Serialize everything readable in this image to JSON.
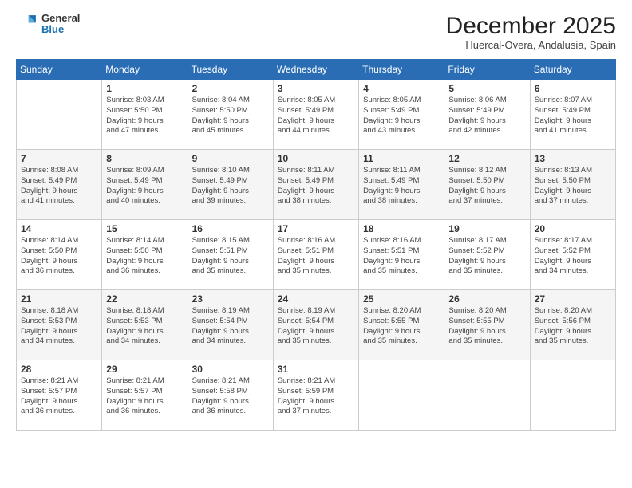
{
  "logo": {
    "general": "General",
    "blue": "Blue"
  },
  "header": {
    "title": "December 2025",
    "subtitle": "Huercal-Overa, Andalusia, Spain"
  },
  "weekdays": [
    "Sunday",
    "Monday",
    "Tuesday",
    "Wednesday",
    "Thursday",
    "Friday",
    "Saturday"
  ],
  "weeks": [
    [
      {
        "day": "",
        "sunrise": "",
        "sunset": "",
        "daylight": ""
      },
      {
        "day": "1",
        "sunrise": "Sunrise: 8:03 AM",
        "sunset": "Sunset: 5:50 PM",
        "daylight": "Daylight: 9 hours and 47 minutes."
      },
      {
        "day": "2",
        "sunrise": "Sunrise: 8:04 AM",
        "sunset": "Sunset: 5:50 PM",
        "daylight": "Daylight: 9 hours and 45 minutes."
      },
      {
        "day": "3",
        "sunrise": "Sunrise: 8:05 AM",
        "sunset": "Sunset: 5:49 PM",
        "daylight": "Daylight: 9 hours and 44 minutes."
      },
      {
        "day": "4",
        "sunrise": "Sunrise: 8:05 AM",
        "sunset": "Sunset: 5:49 PM",
        "daylight": "Daylight: 9 hours and 43 minutes."
      },
      {
        "day": "5",
        "sunrise": "Sunrise: 8:06 AM",
        "sunset": "Sunset: 5:49 PM",
        "daylight": "Daylight: 9 hours and 42 minutes."
      },
      {
        "day": "6",
        "sunrise": "Sunrise: 8:07 AM",
        "sunset": "Sunset: 5:49 PM",
        "daylight": "Daylight: 9 hours and 41 minutes."
      }
    ],
    [
      {
        "day": "7",
        "sunrise": "Sunrise: 8:08 AM",
        "sunset": "Sunset: 5:49 PM",
        "daylight": "Daylight: 9 hours and 41 minutes."
      },
      {
        "day": "8",
        "sunrise": "Sunrise: 8:09 AM",
        "sunset": "Sunset: 5:49 PM",
        "daylight": "Daylight: 9 hours and 40 minutes."
      },
      {
        "day": "9",
        "sunrise": "Sunrise: 8:10 AM",
        "sunset": "Sunset: 5:49 PM",
        "daylight": "Daylight: 9 hours and 39 minutes."
      },
      {
        "day": "10",
        "sunrise": "Sunrise: 8:11 AM",
        "sunset": "Sunset: 5:49 PM",
        "daylight": "Daylight: 9 hours and 38 minutes."
      },
      {
        "day": "11",
        "sunrise": "Sunrise: 8:11 AM",
        "sunset": "Sunset: 5:49 PM",
        "daylight": "Daylight: 9 hours and 38 minutes."
      },
      {
        "day": "12",
        "sunrise": "Sunrise: 8:12 AM",
        "sunset": "Sunset: 5:50 PM",
        "daylight": "Daylight: 9 hours and 37 minutes."
      },
      {
        "day": "13",
        "sunrise": "Sunrise: 8:13 AM",
        "sunset": "Sunset: 5:50 PM",
        "daylight": "Daylight: 9 hours and 37 minutes."
      }
    ],
    [
      {
        "day": "14",
        "sunrise": "Sunrise: 8:14 AM",
        "sunset": "Sunset: 5:50 PM",
        "daylight": "Daylight: 9 hours and 36 minutes."
      },
      {
        "day": "15",
        "sunrise": "Sunrise: 8:14 AM",
        "sunset": "Sunset: 5:50 PM",
        "daylight": "Daylight: 9 hours and 36 minutes."
      },
      {
        "day": "16",
        "sunrise": "Sunrise: 8:15 AM",
        "sunset": "Sunset: 5:51 PM",
        "daylight": "Daylight: 9 hours and 35 minutes."
      },
      {
        "day": "17",
        "sunrise": "Sunrise: 8:16 AM",
        "sunset": "Sunset: 5:51 PM",
        "daylight": "Daylight: 9 hours and 35 minutes."
      },
      {
        "day": "18",
        "sunrise": "Sunrise: 8:16 AM",
        "sunset": "Sunset: 5:51 PM",
        "daylight": "Daylight: 9 hours and 35 minutes."
      },
      {
        "day": "19",
        "sunrise": "Sunrise: 8:17 AM",
        "sunset": "Sunset: 5:52 PM",
        "daylight": "Daylight: 9 hours and 35 minutes."
      },
      {
        "day": "20",
        "sunrise": "Sunrise: 8:17 AM",
        "sunset": "Sunset: 5:52 PM",
        "daylight": "Daylight: 9 hours and 34 minutes."
      }
    ],
    [
      {
        "day": "21",
        "sunrise": "Sunrise: 8:18 AM",
        "sunset": "Sunset: 5:53 PM",
        "daylight": "Daylight: 9 hours and 34 minutes."
      },
      {
        "day": "22",
        "sunrise": "Sunrise: 8:18 AM",
        "sunset": "Sunset: 5:53 PM",
        "daylight": "Daylight: 9 hours and 34 minutes."
      },
      {
        "day": "23",
        "sunrise": "Sunrise: 8:19 AM",
        "sunset": "Sunset: 5:54 PM",
        "daylight": "Daylight: 9 hours and 34 minutes."
      },
      {
        "day": "24",
        "sunrise": "Sunrise: 8:19 AM",
        "sunset": "Sunset: 5:54 PM",
        "daylight": "Daylight: 9 hours and 35 minutes."
      },
      {
        "day": "25",
        "sunrise": "Sunrise: 8:20 AM",
        "sunset": "Sunset: 5:55 PM",
        "daylight": "Daylight: 9 hours and 35 minutes."
      },
      {
        "day": "26",
        "sunrise": "Sunrise: 8:20 AM",
        "sunset": "Sunset: 5:55 PM",
        "daylight": "Daylight: 9 hours and 35 minutes."
      },
      {
        "day": "27",
        "sunrise": "Sunrise: 8:20 AM",
        "sunset": "Sunset: 5:56 PM",
        "daylight": "Daylight: 9 hours and 35 minutes."
      }
    ],
    [
      {
        "day": "28",
        "sunrise": "Sunrise: 8:21 AM",
        "sunset": "Sunset: 5:57 PM",
        "daylight": "Daylight: 9 hours and 36 minutes."
      },
      {
        "day": "29",
        "sunrise": "Sunrise: 8:21 AM",
        "sunset": "Sunset: 5:57 PM",
        "daylight": "Daylight: 9 hours and 36 minutes."
      },
      {
        "day": "30",
        "sunrise": "Sunrise: 8:21 AM",
        "sunset": "Sunset: 5:58 PM",
        "daylight": "Daylight: 9 hours and 36 minutes."
      },
      {
        "day": "31",
        "sunrise": "Sunrise: 8:21 AM",
        "sunset": "Sunset: 5:59 PM",
        "daylight": "Daylight: 9 hours and 37 minutes."
      },
      {
        "day": "",
        "sunrise": "",
        "sunset": "",
        "daylight": ""
      },
      {
        "day": "",
        "sunrise": "",
        "sunset": "",
        "daylight": ""
      },
      {
        "day": "",
        "sunrise": "",
        "sunset": "",
        "daylight": ""
      }
    ]
  ]
}
